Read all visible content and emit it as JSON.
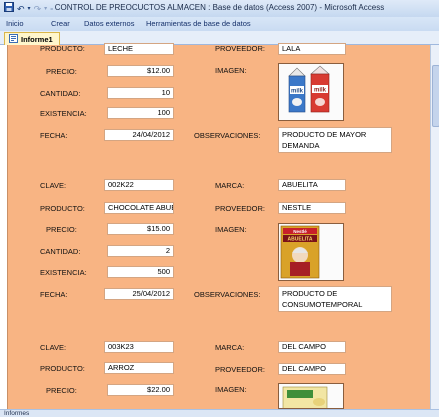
{
  "window": {
    "title": "CONTROL DE PREOCUCTOS ALMACEN : Base de datos (Access 2007) - Microsoft Access"
  },
  "ribbon": {
    "tabs": [
      "Inicio",
      "Crear",
      "Datos externos",
      "Herramientas de base de datos"
    ]
  },
  "document_tab": {
    "label": "Informe1"
  },
  "labels": {
    "clave": "CLAVE:",
    "marca": "MARCA:",
    "producto": "PRODUCTO:",
    "proveedor": "PROVEEDOR:",
    "precio": "PRECIO:",
    "imagen": "IMAGEN:",
    "cantidad": "CANTIDAD:",
    "existencia": "EXISTENCIA:",
    "fecha": "FECHA:",
    "observaciones": "OBSERVACIONES:"
  },
  "records": [
    {
      "clave": "",
      "marca": "",
      "producto": "LECHE",
      "proveedor": "LALA",
      "precio": "$12.00",
      "imagen": "milk-cartons",
      "cantidad": "10",
      "existencia": "100",
      "fecha": "24/04/2012",
      "observaciones": "PRODUCTO DE MAYOR DEMANDA"
    },
    {
      "clave": "002K22",
      "marca": "ABUELITA",
      "producto": "CHOCOLATE ABUE",
      "proveedor": "NESTLE",
      "precio": "$15.00",
      "imagen": "abuelita-chocolate-box",
      "cantidad": "2",
      "existencia": "500",
      "fecha": "25/04/2012",
      "observaciones": "PRODUCTO DE CONSUMOTEMPORAL"
    },
    {
      "clave": "003K23",
      "marca": "DEL CAMPO",
      "producto": "ARROZ",
      "proveedor": "DEL CAMPO",
      "precio": "$22.00",
      "imagen": "rice-package",
      "cantidad": "",
      "existencia": "",
      "fecha": "",
      "observaciones": ""
    }
  ],
  "statusbar": {
    "text": "Informes"
  },
  "colors": {
    "report_background": "#f8b483",
    "field_background": "#ffffff",
    "ribbon": "#c9dbf2"
  }
}
